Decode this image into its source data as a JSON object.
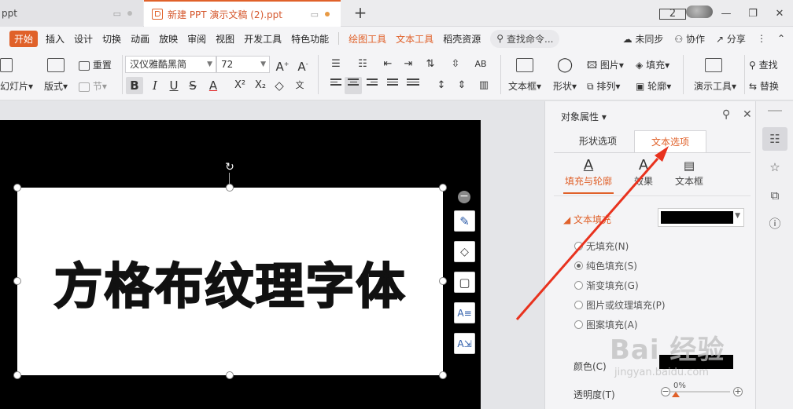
{
  "tabs": {
    "tab1_label": "ppt",
    "tab2_label": "新建 PPT 演示文稿 (2).ppt",
    "new_tab": "+"
  },
  "window": {
    "badge": "2"
  },
  "menu": {
    "items": [
      "开始",
      "插入",
      "设计",
      "切换",
      "动画",
      "放映",
      "审阅",
      "视图",
      "开发工具",
      "特色功能"
    ],
    "tools": [
      "绘图工具",
      "文本工具",
      "稻壳资源"
    ],
    "search": "查找命令...",
    "sync": "未同步",
    "collab": "协作",
    "share": "分享"
  },
  "toolbar": {
    "new_slide": "幻灯片",
    "layout": "版式",
    "reset": "重置",
    "section": "节",
    "font_name": "汉仪雅酷黑简",
    "font_size": "72",
    "textbox": "文本框",
    "shape": "形状",
    "picture": "图片",
    "fill": "填充",
    "arrange": "排列",
    "outline": "轮廓",
    "presentation_tools": "演示工具",
    "find": "查找",
    "replace": "替换"
  },
  "slide": {
    "text": "方格布纹理字体"
  },
  "pane": {
    "title": "对象属性",
    "tab_shape": "形状选项",
    "tab_text": "文本选项",
    "sub_fill": "填充与轮廓",
    "sub_effect": "效果",
    "sub_textbox": "文本框",
    "section_fill": "文本填充",
    "options": [
      "无填充(N)",
      "纯色填充(S)",
      "渐变填充(G)",
      "图片或纹理填充(P)",
      "图案填充(A)"
    ],
    "selected_option": 1,
    "color_label": "颜色(C)",
    "fill_color": "#000000",
    "transparency_label": "透明度(T)",
    "transparency_value": "0%"
  },
  "watermark": {
    "line1": "Bai 经验",
    "line2": "jingyan.baidu.com"
  },
  "colors": {
    "accent": "#e0612a",
    "arrow": "#e8321e"
  }
}
